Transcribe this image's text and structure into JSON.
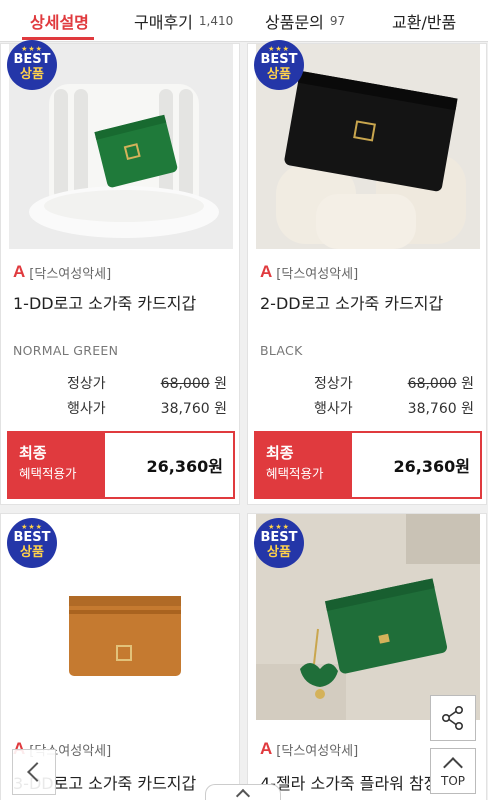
{
  "tabs": [
    {
      "label": "상세설명",
      "count": ""
    },
    {
      "label": "구매후기",
      "count": "1,410"
    },
    {
      "label": "상품문의",
      "count": "97"
    },
    {
      "label": "교환/반품",
      "count": ""
    }
  ],
  "badge": {
    "line1": "BEST",
    "line2": "상품"
  },
  "price_labels": {
    "regular": "정상가",
    "event": "행사가",
    "final_line1": "최종",
    "final_line2": "혜택적용가"
  },
  "products": [
    {
      "brand": "[닥스여성악세]",
      "name": "1-DD로고 소가죽 카드지갑",
      "color": "NORMAL GREEN",
      "regular_price": "68,000",
      "event_price": "38,760",
      "final_price": "26,360원"
    },
    {
      "brand": "[닥스여성악세]",
      "name": "2-DD로고 소가죽 카드지갑",
      "color": "BLACK",
      "regular_price": "68,000",
      "event_price": "38,760",
      "final_price": "26,360원"
    },
    {
      "brand": "[닥스여성악세]",
      "name": "3-DD로고 소가죽 카드지갑"
    },
    {
      "brand": "[닥스여성악세]",
      "name": "4-젤라 소가죽 플라워 참장"
    }
  ],
  "won": "원",
  "top_label": "TOP",
  "colors": {
    "accent": "#e03a3e",
    "badge": "#2436a8"
  }
}
